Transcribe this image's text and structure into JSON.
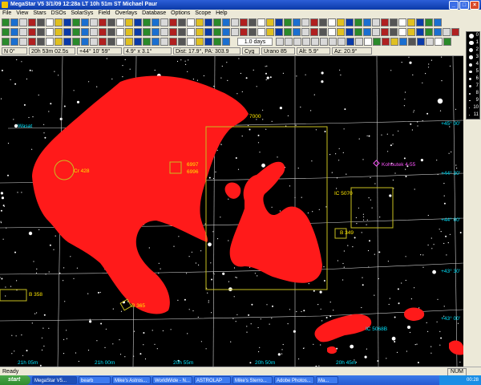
{
  "window": {
    "title": "MegaStar V5    3/1/09  12:28a LT    10h 51m ST    Michael Paur"
  },
  "menu": [
    "File",
    "View",
    "Stars",
    "DSOs",
    "SolarSys",
    "Field",
    "Overlays",
    "Database",
    "Options",
    "Scope",
    "Help"
  ],
  "toolbar": {
    "time_step": "1.0 days"
  },
  "info": {
    "field_of_view": "N 0°",
    "ra": "20h 53m 02.5s",
    "dec": "+44° 10' 59\"",
    "size": "4.9° x 3.1°",
    "dist": "Dist: 17.9°, PA: 303.9",
    "constellation": "Cyg",
    "atlas": "Urano 85",
    "alt": "Alt: 5.9°",
    "az": "Az: 20.9°"
  },
  "chart": {
    "dec_labels": [
      "+45° 00'",
      "+44° 30'",
      "+44° 00'",
      "+43° 30'",
      "+43° 00'"
    ],
    "ra_labels": [
      "21h 05m",
      "21h 00m",
      "20h 55m",
      "20h 50m",
      "20h 45m"
    ],
    "objects": [
      "7000",
      "6997",
      "6996",
      "Cr 428",
      "IC 5070",
      "B 349",
      "B 358",
      "B 365",
      "Kohoutek 4-55",
      "IC 5068B",
      "Wasat"
    ],
    "mag_scale": [
      "0",
      "1",
      "2",
      "3",
      "4",
      "5",
      "6",
      "7",
      "8",
      "9",
      "10",
      "11"
    ]
  },
  "status": {
    "text": "Ready",
    "num": "NUM"
  },
  "taskbar": {
    "start": "start",
    "tasks": [
      "MegaStar V5...",
      "bearb",
      "Mike's Astros...",
      "WorldWide - N...",
      "ASTROLAP",
      "Mike's Sterro...",
      "Adobe Photos...",
      "Ma..."
    ],
    "clock": "00:28"
  },
  "colors": {
    "nebula": "#ff1a1a",
    "grid": "#ffffff",
    "annotation": "#ffe800",
    "dec_label": "#00e5ff",
    "planetary": "#ff55ff"
  }
}
